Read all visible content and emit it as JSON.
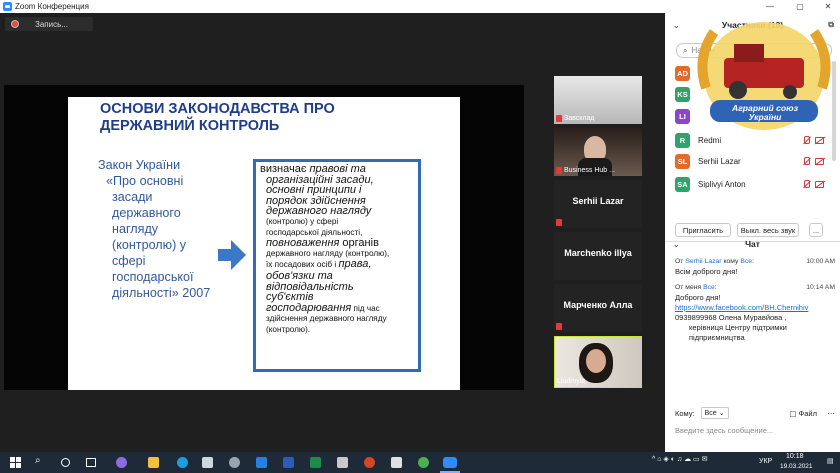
{
  "window": {
    "title": "Zoom Конференция",
    "controls": [
      "—",
      "▢",
      "✕"
    ]
  },
  "recording": {
    "label": "Запись..."
  },
  "slide": {
    "title_lines": [
      "ОСНОВИ ЗАКОНОДАВСТВА  ПРО",
      "ДЕРЖАВНИЙ КОНТРОЛЬ"
    ],
    "left_lines": [
      "Закон України",
      "«Про основні",
      "засади",
      "державного",
      "нагляду",
      "(контролю) у",
      "сфері",
      "господарської",
      "діяльності» 2007"
    ],
    "box": {
      "t01": "визначає ",
      "t02": "правові та",
      "t03": "організаційні засади,",
      "t04": "основні принципи і",
      "t05": "порядок здійснення",
      "t06": "державного нагляду",
      "t07": "(контролю) у сфері",
      "t08": "господарської діяльності,",
      "t09": "повноваження",
      "t10": " органів",
      "t11": "державного нагляду (контролю),",
      "t12": "їх посадових осіб і ",
      "t13": "права,",
      "t14": "обов'язки та",
      "t15": "відповідальність",
      "t16": "суб'єктів",
      "t17": "господарювання",
      "t18": " під час",
      "t19": "здійснення державного нагляду",
      "t20": "(контролю)."
    }
  },
  "tiles": [
    {
      "name": "",
      "sub": "Завсклад"
    },
    {
      "name": "",
      "sub": "Business Hub ..."
    },
    {
      "name": "Serhii Lazar",
      "sub": ""
    },
    {
      "name": "Marchenko illya",
      "sub": ""
    },
    {
      "name": "Марченко Алла",
      "sub": ""
    },
    {
      "name": "",
      "sub": "Liudmyla"
    }
  ],
  "participants": {
    "header": "Участники (18)",
    "search_placeholder": "Найти",
    "list": [
      {
        "initials": "AD",
        "name": "",
        "color": "#e36a2c"
      },
      {
        "initials": "KS",
        "name": "",
        "color": "#2ea36a"
      },
      {
        "initials": "LI",
        "name": "",
        "color": "#8a46c8"
      },
      {
        "initials": "R",
        "name": "Redmi",
        "color": "#2ea36a"
      },
      {
        "initials": "SL",
        "name": "Serhii Lazar",
        "color": "#e36a2c"
      },
      {
        "initials": "SA",
        "name": "Siplivyi  Anton",
        "color": "#2ea36a"
      }
    ],
    "invite": "Пригласить",
    "mute_all": "Выкл. весь звук",
    "more": "..."
  },
  "chat": {
    "header": "Чат",
    "messages": [
      {
        "from_prefix": "От ",
        "from": "Serhii Lazar",
        "mid": " кому ",
        "to": "Все",
        "suffix": ":",
        "time": "10:00 AM",
        "lines": [
          "Всім доброго дня!"
        ],
        "link": ""
      },
      {
        "from_prefix": "От ",
        "from": "меня",
        "mid": " ",
        "to": "Все",
        "suffix": ":",
        "time": "10:14 AM",
        "lines": [
          "Доброго дня!"
        ],
        "link": "https://www.facebook.com/BH.Chernihiv",
        "after_link": "0939899968 Олена Муравйова ,",
        "after_link2": "керівниця Центру підтримки",
        "after_link3": "підприємництва"
      }
    ],
    "to_label": "Кому:",
    "to_value": "Все",
    "file_label": "Файл",
    "input_placeholder": "Введите здесь сообщение..."
  },
  "logo": {
    "line1": "Аграрний союз",
    "line2": "України"
  },
  "taskbar": {
    "lang": "УКР",
    "time": "10:18",
    "date": "19.03.2021"
  }
}
